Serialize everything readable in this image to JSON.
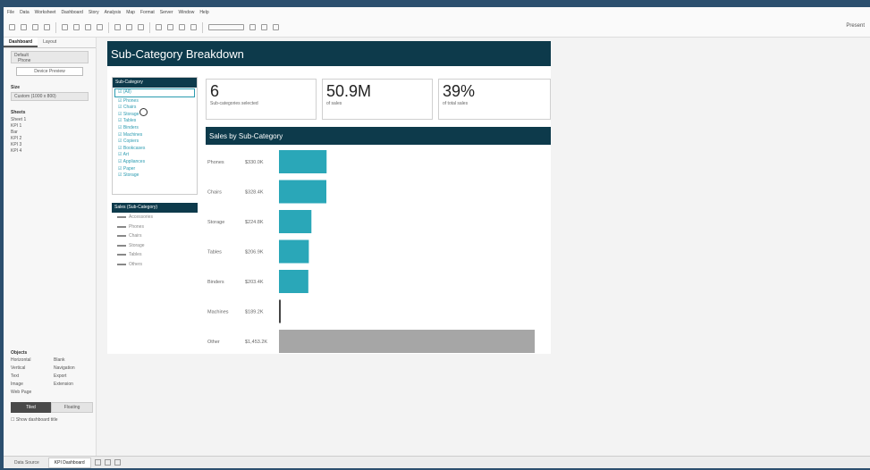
{
  "menu": [
    "File",
    "Data",
    "Worksheet",
    "Dashboard",
    "Story",
    "Analysis",
    "Map",
    "Format",
    "Server",
    "Window",
    "Help"
  ],
  "toolbar": {
    "right_label": "Present"
  },
  "left_pane": {
    "tabs": [
      "Dashboard",
      "Layout"
    ],
    "device_preview": {
      "header": "Default",
      "value": "Phone",
      "button": "Device Preview"
    },
    "size": {
      "header": "Size",
      "value": "Custom (1000 x 800)"
    },
    "sheets": {
      "header": "Sheets",
      "items": [
        "Sheet 1",
        "KPI 1",
        "Bar",
        "KPI 2",
        "KPI 3",
        "KPI 4"
      ]
    },
    "objects": {
      "header": "Objects",
      "items": [
        "Horizontal",
        "Blank",
        "Vertical",
        "Navigation",
        "Text",
        "Export",
        "Image",
        "Extension",
        "Web Page"
      ]
    },
    "tiled": "Tiled",
    "floating": "Floating",
    "show_title": "Show dashboard title"
  },
  "dashboard": {
    "title": "Sub-Category Breakdown",
    "filter": {
      "header": "Sub-Category",
      "items": [
        "(All)",
        "Phones",
        "Chairs",
        "Storage",
        "Tables",
        "Binders",
        "Machines",
        "Copiers",
        "Bookcases",
        "Art",
        "Appliances",
        "Paper",
        "Storage"
      ],
      "selected_index": 0
    },
    "legend": {
      "header": "Sales (Sub-Category)",
      "items": [
        "Accessories",
        "Phones",
        "Chairs",
        "Storage",
        "Tables",
        "Others"
      ]
    },
    "kpis": [
      {
        "value": "6",
        "label": "Sub-categories selected"
      },
      {
        "value": "50.9M",
        "label": "of sales"
      },
      {
        "value": "39%",
        "label": "of total sales"
      }
    ],
    "chart_header": "Sales by Sub-Category"
  },
  "chart_data": {
    "type": "bar",
    "orientation": "horizontal",
    "categories": [
      "Phones",
      "Chairs",
      "Storage",
      "Tables",
      "Binders",
      "Machines",
      "Other"
    ],
    "value_labels": [
      "$330.0K",
      "$328.4K",
      "$224.8K",
      "$206.9K",
      "$203.4K",
      "$189.2K",
      "$1,453.2K"
    ],
    "values": [
      330.0,
      328.4,
      224.8,
      206.9,
      203.4,
      189.2,
      1453.2
    ],
    "colors": [
      "#2aa7b8",
      "#2aa7b8",
      "#2aa7b8",
      "#2aa7b8",
      "#2aa7b8",
      "#444444",
      "#a6a6a6"
    ],
    "xlim": [
      0,
      1453.2
    ]
  },
  "status_tabs": [
    "Data Source",
    "KPI Dashboard"
  ]
}
